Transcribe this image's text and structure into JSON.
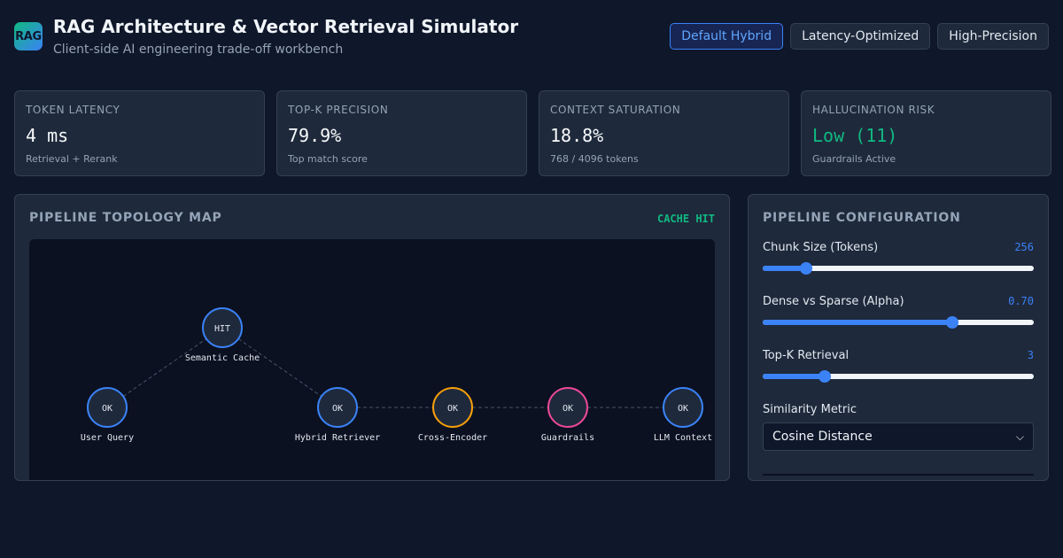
{
  "header": {
    "logo_text": "RAG",
    "title": "RAG Architecture & Vector Retrieval Simulator",
    "subtitle": "Client-side AI engineering trade-off workbench",
    "presets": [
      {
        "label": "Default Hybrid",
        "active": true
      },
      {
        "label": "Latency-Optimized",
        "active": false
      },
      {
        "label": "High-Precision",
        "active": false
      }
    ]
  },
  "metrics": [
    {
      "label": "Token Latency",
      "value": "4 ms",
      "sub": "Retrieval + Rerank"
    },
    {
      "label": "Top-K Precision",
      "value": "79.9%",
      "sub": "Top match score"
    },
    {
      "label": "Context Saturation",
      "value": "18.8%",
      "sub": "768 / 4096 tokens"
    },
    {
      "label": "Hallucination Risk",
      "value": "Low (11)",
      "sub": "Guardrails Active",
      "status_color": "#10b981"
    }
  ],
  "topology": {
    "title": "PIPELINE TOPOLOGY MAP",
    "cache_status": "CACHE HIT",
    "nodes": [
      {
        "id": "query",
        "label": "User Query",
        "status": "OK",
        "color": "#3b82f6"
      },
      {
        "id": "cache",
        "label": "Semantic Cache",
        "status": "HIT",
        "color": "#3b82f6"
      },
      {
        "id": "retriever",
        "label": "Hybrid Retriever",
        "status": "OK",
        "color": "#3b82f6"
      },
      {
        "id": "reranker",
        "label": "Cross-Encoder",
        "status": "OK",
        "color": "#f59e0b"
      },
      {
        "id": "guardrails",
        "label": "Guardrails",
        "status": "OK",
        "color": "#ec4899"
      },
      {
        "id": "llm",
        "label": "LLM Context",
        "status": "OK",
        "color": "#3b82f6"
      }
    ]
  },
  "config": {
    "title": "PIPELINE CONFIGURATION",
    "chunk_size": {
      "label": "Chunk Size (Tokens)",
      "value": "256",
      "fraction": 0.16
    },
    "alpha": {
      "label": "Dense vs Sparse (Alpha)",
      "value": "0.70",
      "fraction": 0.7
    },
    "top_k": {
      "label": "Top-K Retrieval",
      "value": "3",
      "fraction": 0.23
    },
    "metric": {
      "label": "Similarity Metric",
      "selected": "Cosine Distance"
    }
  },
  "colors": {
    "accent": "#3b82f6",
    "success": "#10b981",
    "warning": "#f59e0b",
    "guard": "#ec4899"
  }
}
